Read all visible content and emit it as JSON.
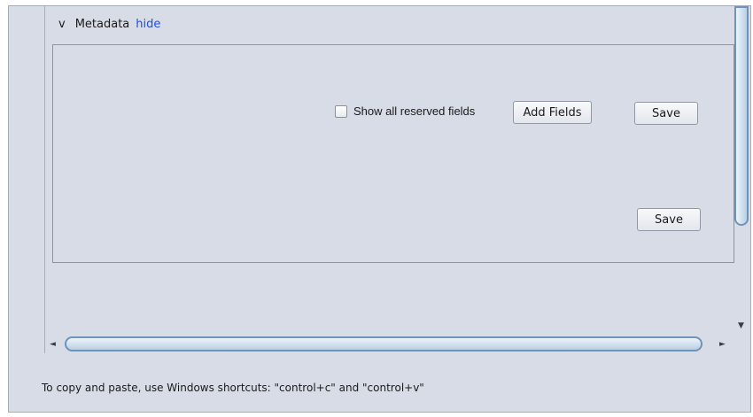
{
  "metadata_section": {
    "collapse_glyph": "v",
    "title": "Metadata",
    "hide_link": "hide"
  },
  "panel": {
    "show_reserved_label": "Show all reserved fields",
    "show_reserved_checked": false,
    "add_fields_label": "Add Fields",
    "save_label_top": "Save",
    "save_label_bottom": "Save"
  },
  "scrollbars": {
    "down_arrow": "▼",
    "left_arrow": "◄",
    "right_arrow": "►"
  },
  "footer_text": "To copy and paste, use Windows shortcuts: \"control+c\" and \"control+v\""
}
